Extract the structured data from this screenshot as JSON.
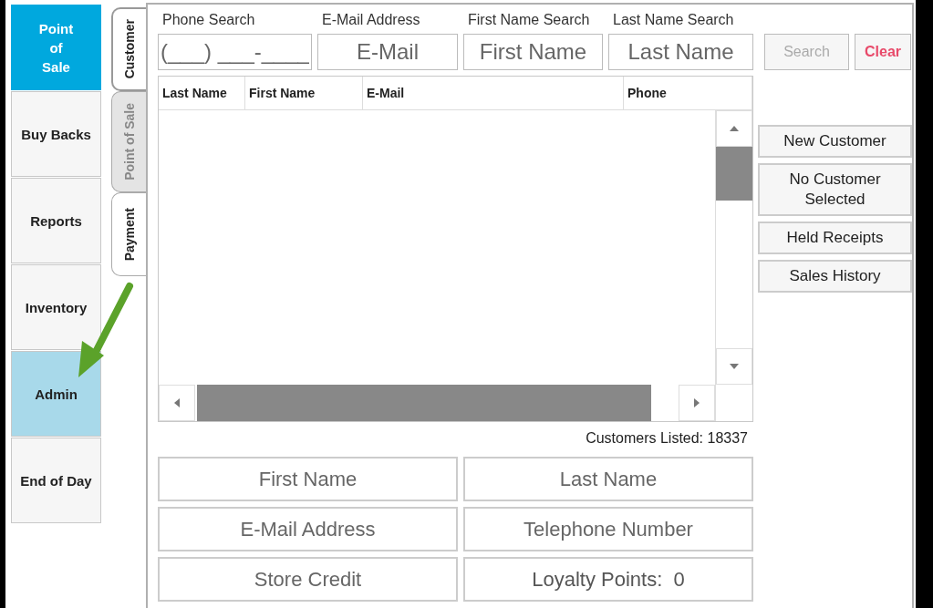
{
  "nav": [
    {
      "label": "Point\nof\nSale",
      "selected": true,
      "highlighted": false
    },
    {
      "label": "Buy Backs",
      "selected": false,
      "highlighted": false
    },
    {
      "label": "Reports",
      "selected": false,
      "highlighted": false
    },
    {
      "label": "Inventory",
      "selected": false,
      "highlighted": false
    },
    {
      "label": "Admin",
      "selected": false,
      "highlighted": true
    },
    {
      "label": "End of Day",
      "selected": false,
      "highlighted": false
    }
  ],
  "tabs": [
    {
      "label": "Customer",
      "selected": true,
      "disabled": false
    },
    {
      "label": "Point of Sale",
      "selected": false,
      "disabled": true
    },
    {
      "label": "Payment",
      "selected": false,
      "disabled": false
    }
  ],
  "search_fields": [
    {
      "label": "Phone Search",
      "placeholder": "(___) ___-____"
    },
    {
      "label": "E-Mail Address",
      "placeholder": "E-Mail"
    },
    {
      "label": "First Name Search",
      "placeholder": "First Name"
    },
    {
      "label": "Last Name Search",
      "placeholder": "Last Name"
    }
  ],
  "search_buttons": [
    {
      "label": "Search",
      "kind": "disabled"
    },
    {
      "label": "Clear",
      "kind": "danger"
    }
  ],
  "table": {
    "columns": [
      "Last Name",
      "First Name",
      "E-Mail",
      "Phone"
    ]
  },
  "side_buttons": [
    "New Customer",
    "No Customer Selected",
    "Held Receipts",
    "Sales History"
  ],
  "customers_listed": "Customers Listed: 18337",
  "detail_fields": [
    {
      "kind": "field",
      "placeholder": "First Name"
    },
    {
      "kind": "field",
      "placeholder": "Last Name"
    },
    {
      "kind": "field",
      "placeholder": "E-Mail Address"
    },
    {
      "kind": "field",
      "placeholder": "Telephone Number"
    },
    {
      "kind": "field",
      "placeholder": "Store Credit"
    },
    {
      "kind": "readout",
      "text": "Loyalty Points:  0"
    }
  ]
}
